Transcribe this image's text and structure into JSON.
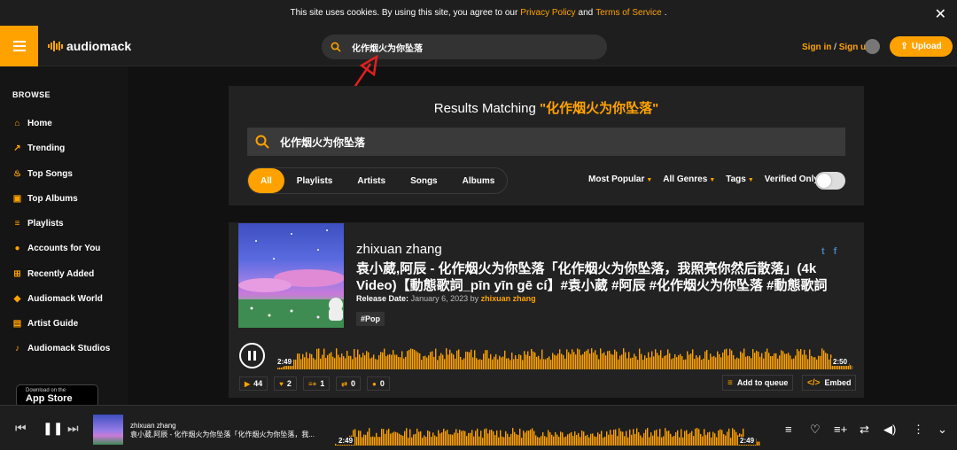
{
  "cookie": {
    "text_before": "This site uses cookies. By using this site, you agree to our",
    "privacy": "Privacy Policy",
    "and": "and",
    "terms": "Terms of Service",
    "period": ".",
    "close": "✕"
  },
  "header": {
    "logo": "audiomack",
    "search_value": "化作烟火为你坠落",
    "sign_in": "Sign in",
    "slash": " / ",
    "sign_up": "Sign up",
    "upload": "Upload"
  },
  "sidebar": {
    "heading": "BROWSE",
    "items": [
      {
        "label": "Home",
        "icon": "home-icon",
        "glyph": "⌂"
      },
      {
        "label": "Trending",
        "icon": "trending-icon",
        "glyph": "↗"
      },
      {
        "label": "Top Songs",
        "icon": "fire-icon",
        "glyph": "♨"
      },
      {
        "label": "Top Albums",
        "icon": "album-icon",
        "glyph": "▣"
      },
      {
        "label": "Playlists",
        "icon": "playlist-icon",
        "glyph": "≡"
      },
      {
        "label": "Accounts for You",
        "icon": "user-icon",
        "glyph": "●"
      },
      {
        "label": "Recently Added",
        "icon": "plus-box-icon",
        "glyph": "⊞"
      },
      {
        "label": "Audiomack World",
        "icon": "world-icon",
        "glyph": "◆"
      },
      {
        "label": "Artist Guide",
        "icon": "book-icon",
        "glyph": "▤"
      },
      {
        "label": "Audiomack Studios",
        "icon": "mic-icon",
        "glyph": "♪"
      }
    ],
    "appstore_small": "Download on the",
    "appstore_big": "App Store"
  },
  "results": {
    "heading_prefix": "Results Matching",
    "heading_query": "\"化作烟火为你坠落\"",
    "search_value": "化作烟火为你坠落",
    "tabs": [
      "All",
      "Playlists",
      "Artists",
      "Songs",
      "Albums"
    ],
    "active_tab": "All",
    "filters": [
      "Most Popular",
      "All Genres",
      "Tags"
    ],
    "verified_only": "Verified Only",
    "verified_on": false
  },
  "song": {
    "artist": "zhixuan zhang",
    "title": "袁小葳,阿辰 - 化作烟火为你坠落「化作烟火为你坠落，我照亮你然后散落」(4k Video)【動態歌詞_pīn yīn gē cí】#袁小葳 #阿辰 #化作烟火为你坠落 #動態歌詞",
    "release_label": "Release Date:",
    "release_date": "January 6, 2023",
    "by": "by",
    "uploader": "zhixuan zhang",
    "tag": "#Pop",
    "twitter": "t",
    "facebook": "f",
    "time_current": "2:49",
    "time_total": "2:50",
    "progress": 0.994,
    "plays": "44",
    "likes": "2",
    "adds": "1",
    "reposts": "0",
    "comments": "0",
    "add_to_queue": "Add to queue",
    "embed": "Embed"
  },
  "player": {
    "artist": "zhixuan zhang",
    "title": "袁小葳,阿辰 - 化作烟火为你坠落「化作烟火为你坠落，我...",
    "time_current": "2:49",
    "time_total": "2:49",
    "progress": 1.0
  },
  "colors": {
    "accent": "#ffa200",
    "background": "#151515",
    "panel": "#222222"
  }
}
